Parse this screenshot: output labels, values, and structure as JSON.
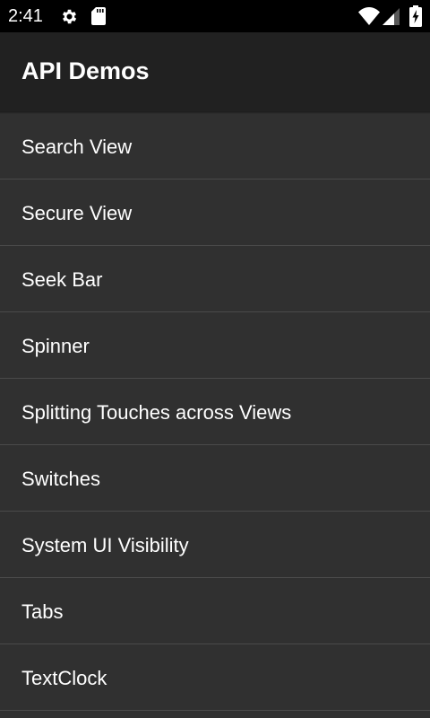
{
  "status_bar": {
    "time": "2:41",
    "icons": [
      "settings-gear-icon",
      "sd-card-icon",
      "wifi-icon",
      "cell-signal-icon",
      "battery-charging-icon"
    ]
  },
  "app_bar": {
    "title": "API Demos"
  },
  "list": {
    "items": [
      {
        "label": "Search View"
      },
      {
        "label": "Secure View"
      },
      {
        "label": "Seek Bar"
      },
      {
        "label": "Spinner"
      },
      {
        "label": "Splitting Touches across Views"
      },
      {
        "label": "Switches"
      },
      {
        "label": "System UI Visibility"
      },
      {
        "label": "Tabs"
      },
      {
        "label": "TextClock"
      }
    ]
  },
  "colors": {
    "status_bar_bg": "#000000",
    "app_bar_bg": "#212121",
    "list_bg": "#303030",
    "divider": "#4a4a4a",
    "text": "#ffffff"
  }
}
